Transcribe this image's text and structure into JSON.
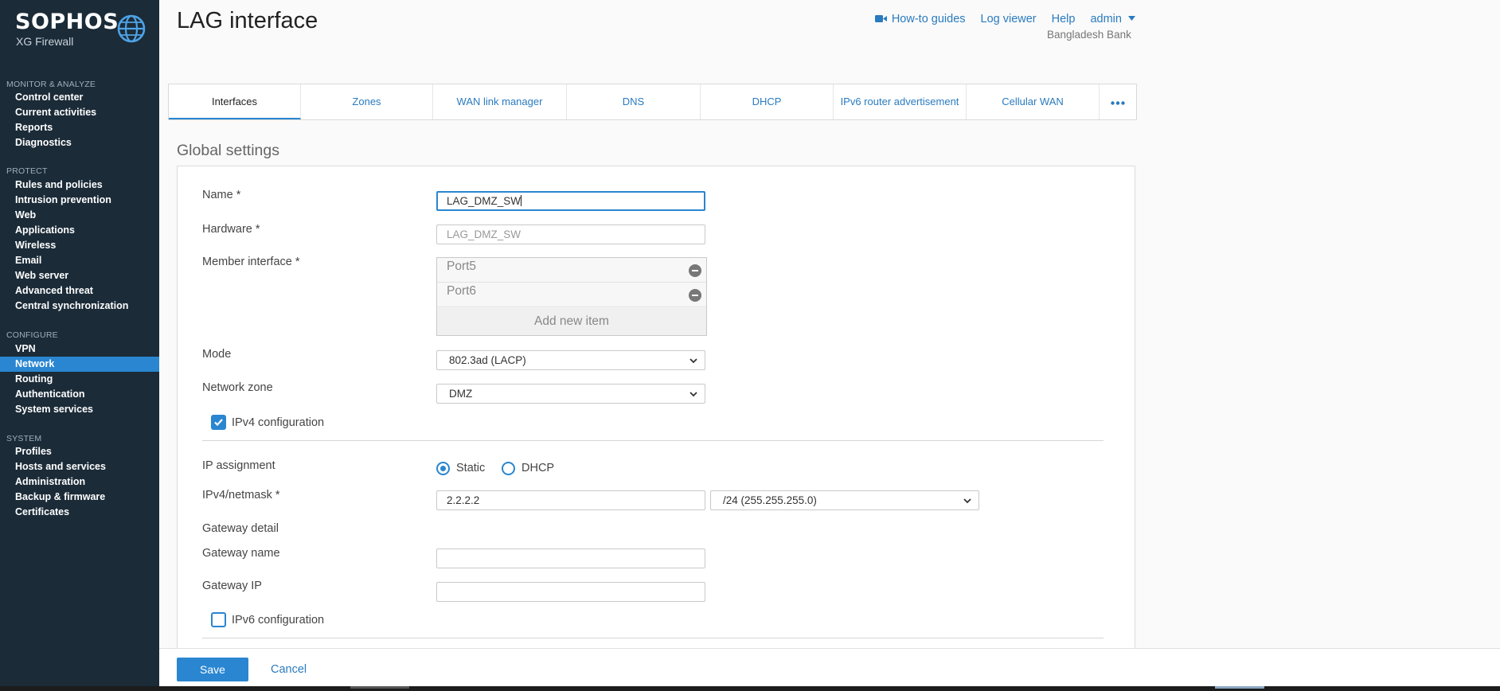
{
  "brand": {
    "name": "SOPHOS",
    "product": "XG Firewall"
  },
  "sidebar": {
    "sections": [
      {
        "title": "MONITOR & ANALYZE",
        "items": [
          "Control center",
          "Current activities",
          "Reports",
          "Diagnostics"
        ]
      },
      {
        "title": "PROTECT",
        "items": [
          "Rules and policies",
          "Intrusion prevention",
          "Web",
          "Applications",
          "Wireless",
          "Email",
          "Web server",
          "Advanced threat",
          "Central synchronization"
        ]
      },
      {
        "title": "CONFIGURE",
        "items": [
          "VPN",
          "Network",
          "Routing",
          "Authentication",
          "System services"
        ]
      },
      {
        "title": "SYSTEM",
        "items": [
          "Profiles",
          "Hosts and services",
          "Administration",
          "Backup & firmware",
          "Certificates"
        ]
      }
    ],
    "active_item": "Network"
  },
  "header": {
    "title": "LAG interface",
    "links": {
      "howto": "How-to guides",
      "log_viewer": "Log viewer",
      "help": "Help",
      "user": "admin"
    },
    "org": "Bangladesh Bank"
  },
  "tabs": [
    "Interfaces",
    "Zones",
    "WAN link manager",
    "DNS",
    "DHCP",
    "IPv6 router advertisement",
    "Cellular WAN"
  ],
  "active_tab": "Interfaces",
  "section_title": "Global settings",
  "form": {
    "name_label": "Name *",
    "name_value": "LAG_DMZ_SW",
    "hardware_label": "Hardware *",
    "hardware_value": "LAG_DMZ_SW",
    "member_label": "Member interface *",
    "members": [
      "Port5",
      "Port6"
    ],
    "add_item": "Add new item",
    "mode_label": "Mode",
    "mode_value": "802.3ad (LACP)",
    "zone_label": "Network zone",
    "zone_value": "DMZ",
    "ipv4_config": "IPv4 configuration",
    "ipv4_checked": true,
    "ip_assignment_label": "IP assignment",
    "ip_static": "Static",
    "ip_dhcp": "DHCP",
    "ip_selected": "Static",
    "ipv4_label": "IPv4/netmask *",
    "ipv4_value": "2.2.2.2",
    "netmask_value": "/24 (255.255.255.0)",
    "gateway_detail": "Gateway detail",
    "gateway_name_label": "Gateway name",
    "gateway_name_value": "",
    "gateway_ip_label": "Gateway IP",
    "gateway_ip_value": "",
    "ipv6_config": "IPv6 configuration",
    "ipv6_checked": false
  },
  "footer": {
    "save": "Save",
    "cancel": "Cancel"
  },
  "colors": {
    "sidebar_bg": "#1b2b38",
    "accent": "#2a86d0",
    "link": "#2a7bbf"
  }
}
